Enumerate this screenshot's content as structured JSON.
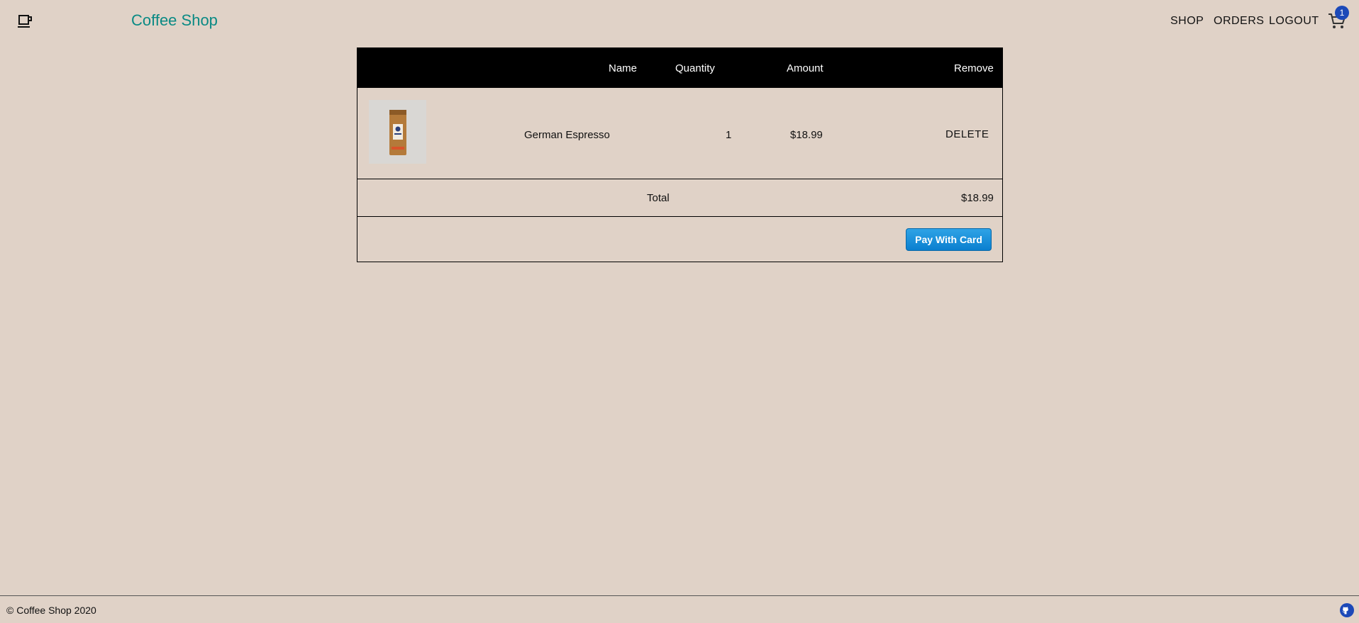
{
  "header": {
    "logo_icon": "coffee-cup-icon",
    "brand": "Coffee Shop",
    "nav": [
      "SHOP",
      "ORDERS",
      "LOGOUT"
    ],
    "cart_icon": "shopping-cart-icon",
    "cart_count": "1",
    "colors": {
      "brand": "#0a8a84",
      "badge": "#1c49b8"
    }
  },
  "cart": {
    "columns": {
      "name": "Name",
      "quantity": "Quantity",
      "amount": "Amount",
      "remove": "Remove"
    },
    "items": [
      {
        "image_icon": "coffee-bag-icon",
        "name": "German Espresso",
        "quantity": "1",
        "amount": "$18.99",
        "remove_label": "DELETE"
      }
    ],
    "total_label": "Total",
    "total_value": "$18.99",
    "pay_button": "Pay With Card",
    "colors": {
      "header_bg": "#000000",
      "pay_button": "#0a7fcf"
    }
  },
  "footer": {
    "copyright": "© Coffee Shop 2020",
    "github_icon": "github-icon"
  },
  "colors": {
    "page_bg": "#e0d2c7"
  }
}
